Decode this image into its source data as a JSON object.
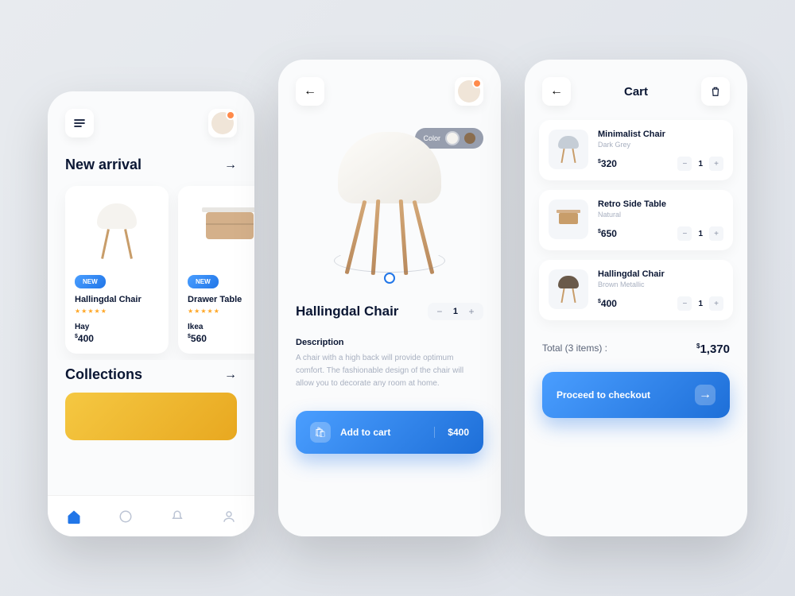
{
  "home": {
    "section_new_arrival": "New arrival",
    "section_collections": "Collections",
    "products": [
      {
        "badge": "NEW",
        "name": "Hallingdal Chair",
        "brand": "Hay",
        "price": "400",
        "stars": "★★★★★"
      },
      {
        "badge": "NEW",
        "name": "Drawer Table",
        "brand": "Ikea",
        "price": "560",
        "stars": "★★★★★"
      }
    ]
  },
  "detail": {
    "color_label": "Color",
    "title": "Hallingdal Chair",
    "qty": "1",
    "desc_label": "Description",
    "desc_text": "A chair with a high back will provide optimum comfort. The fashionable design of the chair will allow you to decorate any room at home.",
    "add_label": "Add to cart",
    "add_price": "$400"
  },
  "cart": {
    "title": "Cart",
    "items": [
      {
        "name": "Minimalist Chair",
        "variant": "Dark Grey",
        "price": "320",
        "qty": "1"
      },
      {
        "name": "Retro Side Table",
        "variant": "Natural",
        "price": "650",
        "qty": "1"
      },
      {
        "name": "Hallingdal Chair",
        "variant": "Brown Metallic",
        "price": "400",
        "qty": "1"
      }
    ],
    "total_label": "Total (3 items) :",
    "total_value": "1,370",
    "checkout_label": "Proceed to checkout"
  }
}
